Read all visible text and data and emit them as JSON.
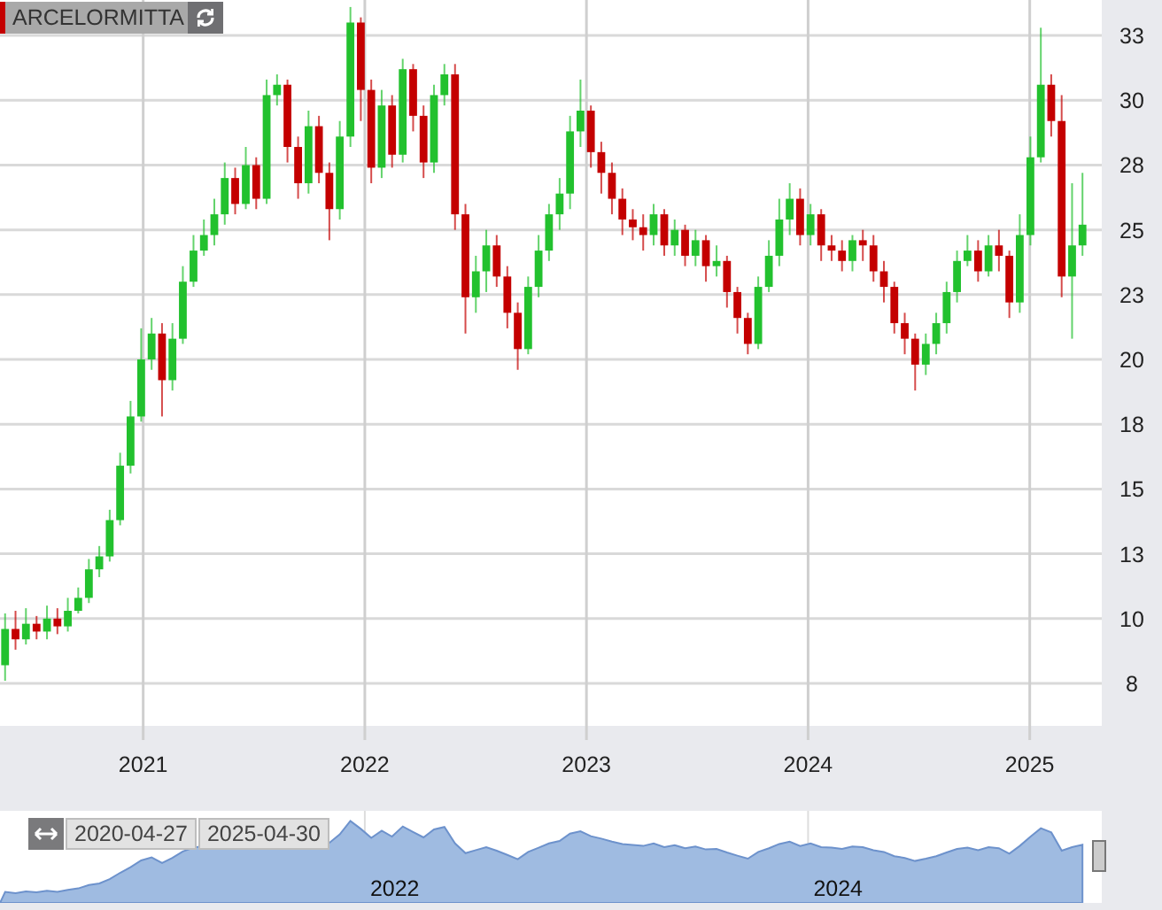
{
  "legend": {
    "symbol": "ARCELORMITTA"
  },
  "chart": {
    "chart_data": {
      "type": "candlestick",
      "grid": true,
      "xlim": [
        2020.354,
        2025.325
      ],
      "ylim": [
        5.86,
        33.87
      ],
      "yticks": [
        {
          "value": 7.5,
          "label": "8"
        },
        {
          "value": 10,
          "label": "10"
        },
        {
          "value": 12.5,
          "label": "13"
        },
        {
          "value": 15,
          "label": "15"
        },
        {
          "value": 17.5,
          "label": "18"
        },
        {
          "value": 20,
          "label": "20"
        },
        {
          "value": 22.5,
          "label": "23"
        },
        {
          "value": 25,
          "label": "25"
        },
        {
          "value": 27.5,
          "label": "28"
        },
        {
          "value": 30,
          "label": "30"
        },
        {
          "value": 32.5,
          "label": "33"
        }
      ],
      "xticks": [
        2021,
        2022,
        2023,
        2024,
        2025
      ],
      "x": [
        2020.377,
        2020.424,
        2020.471,
        2020.519,
        2020.566,
        2020.613,
        2020.66,
        2020.707,
        2020.755,
        2020.802,
        2020.849,
        2020.896,
        2020.943,
        2020.991,
        2021.038,
        2021.085,
        2021.132,
        2021.179,
        2021.227,
        2021.274,
        2021.321,
        2021.368,
        2021.415,
        2021.463,
        2021.51,
        2021.557,
        2021.604,
        2021.651,
        2021.699,
        2021.746,
        2021.793,
        2021.84,
        2021.887,
        2021.935,
        2021.982,
        2022.029,
        2022.076,
        2022.123,
        2022.171,
        2022.218,
        2022.265,
        2022.312,
        2022.359,
        2022.407,
        2022.454,
        2022.501,
        2022.548,
        2022.595,
        2022.643,
        2022.69,
        2022.737,
        2022.784,
        2022.831,
        2022.879,
        2022.926,
        2022.973,
        2023.02,
        2023.067,
        2023.115,
        2023.162,
        2023.209,
        2023.256,
        2023.303,
        2023.351,
        2023.398,
        2023.445,
        2023.492,
        2023.539,
        2023.587,
        2023.634,
        2023.681,
        2023.728,
        2023.775,
        2023.823,
        2023.87,
        2023.917,
        2023.964,
        2024.011,
        2024.059,
        2024.106,
        2024.153,
        2024.2,
        2024.247,
        2024.295,
        2024.342,
        2024.389,
        2024.436,
        2024.483,
        2024.531,
        2024.578,
        2024.625,
        2024.672,
        2024.719,
        2024.767,
        2024.814,
        2024.861,
        2024.908,
        2024.955,
        2025.003,
        2025.05,
        2025.097,
        2025.144,
        2025.191,
        2025.238
      ],
      "ohlc": [
        [
          8.2,
          10.2,
          7.6,
          9.6
        ],
        [
          9.6,
          10.3,
          8.8,
          9.2
        ],
        [
          9.2,
          10.4,
          9.0,
          9.8
        ],
        [
          9.8,
          10.1,
          9.2,
          9.5
        ],
        [
          9.5,
          10.5,
          9.2,
          10.0
        ],
        [
          10.0,
          10.4,
          9.4,
          9.7
        ],
        [
          9.7,
          10.8,
          9.5,
          10.3
        ],
        [
          10.3,
          11.2,
          10.2,
          10.8
        ],
        [
          10.8,
          12.3,
          10.6,
          11.9
        ],
        [
          11.9,
          12.8,
          11.6,
          12.4
        ],
        [
          12.4,
          14.2,
          12.2,
          13.8
        ],
        [
          13.8,
          16.4,
          13.6,
          15.9
        ],
        [
          15.9,
          18.4,
          15.6,
          17.8
        ],
        [
          17.8,
          21.2,
          17.6,
          20.0
        ],
        [
          20.0,
          21.6,
          19.6,
          21.0
        ],
        [
          21.0,
          21.4,
          17.8,
          19.2
        ],
        [
          19.2,
          21.4,
          18.8,
          20.8
        ],
        [
          20.8,
          23.6,
          20.6,
          23.0
        ],
        [
          23.0,
          24.8,
          22.8,
          24.2
        ],
        [
          24.2,
          25.4,
          24.0,
          24.8
        ],
        [
          24.8,
          26.2,
          24.4,
          25.6
        ],
        [
          25.6,
          27.6,
          25.2,
          27.0
        ],
        [
          27.0,
          27.4,
          25.6,
          26.0
        ],
        [
          26.0,
          28.2,
          25.8,
          27.5
        ],
        [
          27.5,
          27.8,
          25.8,
          26.2
        ],
        [
          26.2,
          30.8,
          26.0,
          30.2
        ],
        [
          30.2,
          31.0,
          29.8,
          30.6
        ],
        [
          30.6,
          30.8,
          27.6,
          28.2
        ],
        [
          28.2,
          28.6,
          26.2,
          26.8
        ],
        [
          26.8,
          29.6,
          26.4,
          29.0
        ],
        [
          29.0,
          29.4,
          26.8,
          27.2
        ],
        [
          27.2,
          27.6,
          24.6,
          25.8
        ],
        [
          25.8,
          29.2,
          25.4,
          28.6
        ],
        [
          28.6,
          33.6,
          28.2,
          33.0
        ],
        [
          33.0,
          33.2,
          29.2,
          30.4
        ],
        [
          30.4,
          30.8,
          26.8,
          27.4
        ],
        [
          27.4,
          30.4,
          27.0,
          29.8
        ],
        [
          29.8,
          30.2,
          27.4,
          27.9
        ],
        [
          27.9,
          31.6,
          27.6,
          31.2
        ],
        [
          31.2,
          31.4,
          28.8,
          29.4
        ],
        [
          29.4,
          29.8,
          27.0,
          27.6
        ],
        [
          27.6,
          30.6,
          27.2,
          30.2
        ],
        [
          30.2,
          31.4,
          29.8,
          31.0
        ],
        [
          31.0,
          31.4,
          25.0,
          25.6
        ],
        [
          25.6,
          26.0,
          21.0,
          22.4
        ],
        [
          22.4,
          24.0,
          21.8,
          23.4
        ],
        [
          23.4,
          25.0,
          22.6,
          24.4
        ],
        [
          24.4,
          24.8,
          22.8,
          23.2
        ],
        [
          23.2,
          23.6,
          21.2,
          21.8
        ],
        [
          21.8,
          22.2,
          19.6,
          20.4
        ],
        [
          20.4,
          23.2,
          20.2,
          22.8
        ],
        [
          22.8,
          24.8,
          22.4,
          24.2
        ],
        [
          24.2,
          26.0,
          23.8,
          25.6
        ],
        [
          25.6,
          27.0,
          25.0,
          26.4
        ],
        [
          26.4,
          29.4,
          25.8,
          28.8
        ],
        [
          28.8,
          30.8,
          28.2,
          29.6
        ],
        [
          29.6,
          29.8,
          27.4,
          28.0
        ],
        [
          28.0,
          28.4,
          26.4,
          27.2
        ],
        [
          27.2,
          27.6,
          25.6,
          26.2
        ],
        [
          26.2,
          26.6,
          24.8,
          25.4
        ],
        [
          25.4,
          25.8,
          24.6,
          25.1
        ],
        [
          25.1,
          25.6,
          24.2,
          24.8
        ],
        [
          24.8,
          26.0,
          24.4,
          25.6
        ],
        [
          25.6,
          25.8,
          24.0,
          24.4
        ],
        [
          24.4,
          25.4,
          24.0,
          25.0
        ],
        [
          25.0,
          25.2,
          23.6,
          24.0
        ],
        [
          24.0,
          25.0,
          23.6,
          24.6
        ],
        [
          24.6,
          24.8,
          23.0,
          23.6
        ],
        [
          23.6,
          24.4,
          23.2,
          23.8
        ],
        [
          23.8,
          24.0,
          22.0,
          22.6
        ],
        [
          22.6,
          22.8,
          21.0,
          21.6
        ],
        [
          21.6,
          21.8,
          20.2,
          20.6
        ],
        [
          20.6,
          23.2,
          20.4,
          22.8
        ],
        [
          22.8,
          24.6,
          22.6,
          24.0
        ],
        [
          24.0,
          26.2,
          23.6,
          25.4
        ],
        [
          25.4,
          26.8,
          24.8,
          26.2
        ],
        [
          26.2,
          26.6,
          24.4,
          24.8
        ],
        [
          24.8,
          26.0,
          24.4,
          25.6
        ],
        [
          25.6,
          25.8,
          23.8,
          24.4
        ],
        [
          24.4,
          24.8,
          23.8,
          24.2
        ],
        [
          24.2,
          24.6,
          23.4,
          23.8
        ],
        [
          23.8,
          24.8,
          23.4,
          24.6
        ],
        [
          24.6,
          25.0,
          23.8,
          24.4
        ],
        [
          24.4,
          24.8,
          23.0,
          23.4
        ],
        [
          23.4,
          23.8,
          22.2,
          22.8
        ],
        [
          22.8,
          23.0,
          21.0,
          21.4
        ],
        [
          21.4,
          21.8,
          20.2,
          20.8
        ],
        [
          20.8,
          21.0,
          18.8,
          19.8
        ],
        [
          19.8,
          21.0,
          19.4,
          20.6
        ],
        [
          20.6,
          21.8,
          20.2,
          21.4
        ],
        [
          21.4,
          23.0,
          21.0,
          22.6
        ],
        [
          22.6,
          24.2,
          22.2,
          23.8
        ],
        [
          23.8,
          24.8,
          23.6,
          24.2
        ],
        [
          24.2,
          24.6,
          23.0,
          23.4
        ],
        [
          23.4,
          24.8,
          23.2,
          24.4
        ],
        [
          24.4,
          25.0,
          23.4,
          24.0
        ],
        [
          24.0,
          24.2,
          21.6,
          22.2
        ],
        [
          22.2,
          25.6,
          21.8,
          24.8
        ],
        [
          24.8,
          28.6,
          24.4,
          27.8
        ],
        [
          27.8,
          32.8,
          27.6,
          30.6
        ],
        [
          30.6,
          31.0,
          28.6,
          29.2
        ],
        [
          29.2,
          30.2,
          22.4,
          23.2
        ],
        [
          23.2,
          26.8,
          20.8,
          24.4
        ],
        [
          24.4,
          27.2,
          24.0,
          25.2
        ]
      ]
    }
  },
  "navigator": {
    "from": "2020-04-27",
    "to": "2025-04-30",
    "labels": [
      "2022",
      "2024"
    ]
  }
}
